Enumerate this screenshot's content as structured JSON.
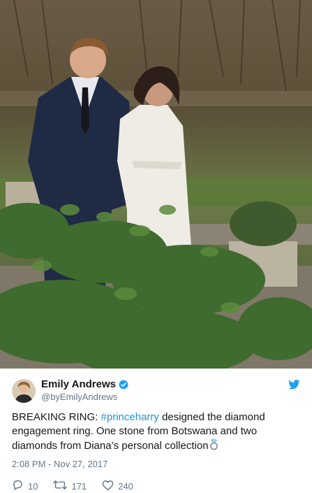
{
  "user": {
    "display_name": "Emily Andrews",
    "handle": "@byEmilyAndrews"
  },
  "tweet": {
    "text_before": "BREAKING RING: ",
    "hashtag": "#princeharry",
    "text_after": " designed the diamond engagement ring. One stone from Botswana and two diamonds from Diana’s personal collection",
    "timestamp": "2:08 PM - Nov 27, 2017"
  },
  "stats": {
    "replies": "10",
    "retweets": "171",
    "likes": "240"
  },
  "colors": {
    "link": "#1b95e0",
    "muted": "#657786",
    "verified": "#1da1f2"
  },
  "icons": [
    "verified-badge-icon",
    "twitter-bird-icon",
    "ring-emoji-icon",
    "reply-icon",
    "retweet-icon",
    "like-icon"
  ]
}
